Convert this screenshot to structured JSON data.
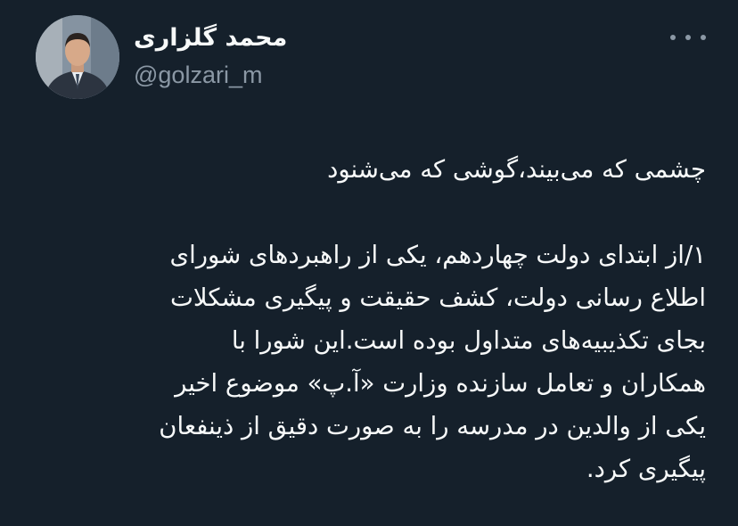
{
  "author": {
    "display_name": "محمد گلزاری",
    "handle": "@golzari_m",
    "avatar_icon": "profile-photo"
  },
  "more_icon": "more-horizontal-icon",
  "tweet": {
    "headline": "چشمی که می‌بیند،گوشی که می‌شنود",
    "body_lines": [
      "۱/از ابتدای دولت چهاردهم، یکی از راهبردهای شورای",
      "اطلاع رسانی دولت، کشف حقیقت و پیگیری مشکلات",
      "بجای تکذیبیه‌های متداول بوده است.این شورا با",
      "همکاران و تعامل سازنده وزارت «آ.پ» موضوع اخیر",
      "یکی از والدین در مدرسه را به صورت دقیق از ذینفعان",
      "پیگیری کرد."
    ]
  },
  "colors": {
    "background": "#15202b",
    "primary_text": "#f7f9f9",
    "secondary_text": "#8b98a5"
  }
}
